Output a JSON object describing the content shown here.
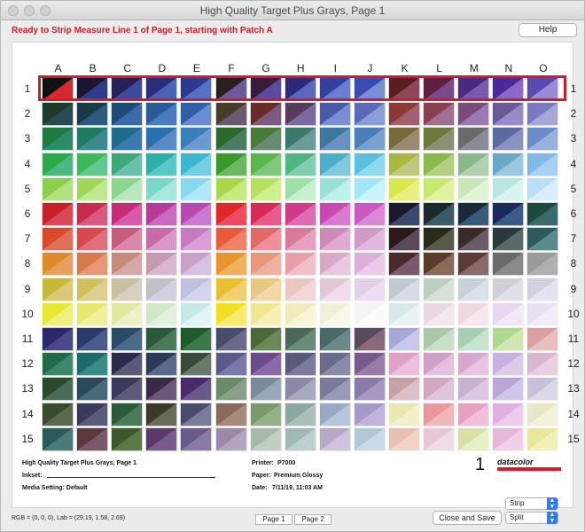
{
  "window": {
    "title": "High Quality Target Plus Grays, Page 1"
  },
  "status": {
    "text": "Ready to Strip Measure Line 1 of Page 1, starting with Patch A"
  },
  "toolbar": {
    "help_label": "Help"
  },
  "target": {
    "columns": [
      "A",
      "B",
      "C",
      "D",
      "E",
      "F",
      "G",
      "H",
      "I",
      "J",
      "K",
      "L",
      "M",
      "N",
      "O"
    ],
    "rows": [
      "1",
      "2",
      "3",
      "4",
      "5",
      "6",
      "7",
      "8",
      "9",
      "10",
      "11",
      "12",
      "13",
      "14",
      "15"
    ],
    "highlighted_row_index": 0,
    "patch_colors": [
      [
        "#111111/#d9282c",
        "#1a1632/#2f3b8c",
        "#252055/#3c4aa0",
        "#2a3078/#4a62b8",
        "#2e3a8c/#5570c8",
        "#2a1f20/#6b5a9a",
        "#3a1c3a/#5a4aa0",
        "#2c2a7a/#5a66c0",
        "#3340a0/#6a7ed0",
        "#3a4cb0/#7a8ed8",
        "#5a1e20/#8a4858",
        "#5e2040/#7a4a8a",
        "#4a2a80/#7a5ab0",
        "#4a2a9a/#8a6ac8",
        "#5a4ab0/#9a8ad8"
      ],
      [
        "#1f3a2a/#2a4a55",
        "#1a3a48/#2e5a80",
        "#1e4a78/#3a6aa8",
        "#2a5a98/#4a7ac0",
        "#3060a8/#6a8cd0",
        "#4a3a2a/#6a5a70",
        "#6a2a2a/#7a5a80",
        "#5a3a5a/#7a6aa0",
        "#4a5aa8/#7a8ed0",
        "#5a6ab8/#8a9ed8",
        "#8a3a30/#a06070",
        "#8a4050/#a07090",
        "#7a4a78/#9a7ab0",
        "#6a5a98/#9a8ac8",
        "#7a7ac0/#a8a8d8"
      ],
      [
        "#1e7a40/#2a8a6a",
        "#1e7a60/#3a8a90",
        "#1e6a88/#3a7ab0",
        "#2a70b0/#5a8ac8",
        "#3a80b8/#6a9ad0",
        "#2a6a2a/#4a7a60",
        "#4a7a3a/#6a8a70",
        "#3a7a6a/#6a9a9a",
        "#3a78a0/#6a90c0",
        "#4a80b8/#7aa0d0",
        "#7a6a3a/#9a8a70",
        "#6a7a3a/#8a9070",
        "#6a6a6a/#8a8a98",
        "#5a6aa0/#8a90c0",
        "#6a8ac8/#98b0dc"
      ],
      [
        "#2aa84a/#4ab880",
        "#3ab85a/#60c890",
        "#3aa878/#6ac0a8",
        "#2ab0a8/#5ac8c8",
        "#3ab8d0/#70d0e0",
        "#3a9a2a/#6ab860",
        "#5ab84a/#80c880",
        "#4ab880/#80d0b0",
        "#4ab0c8/#80c8e0",
        "#5ac0e0/#90d8f0",
        "#a8b83a/#c0c880",
        "#8ab84a/#b0d080",
        "#8ab88a/#b0d0b0",
        "#6aa8c8/#98c8e0",
        "#80b8e8/#a8d0f0"
      ],
      [
        "#8ad04a/#b0e080",
        "#a0d85a/#c0e890",
        "#8ad890/#b8e8c0",
        "#7ad8c8/#a8e8e0",
        "#8ad8f0/#b0e8f8",
        "#a8d84a/#c8e880",
        "#b8e060/#d0f090",
        "#a0e0a8/#c8f0d0",
        "#98e0d8/#c0f0ec",
        "#a0e8f8/#c8f4fc",
        "#d8e84a/#e8f080",
        "#c8e870/#e0f4a0",
        "#c8e8b8/#e0f4d8",
        "#b8e8e0/#d8f4f0",
        "#b8e0f8/#d8eefc"
      ],
      [
        "#c81e2a/#d84858",
        "#c82a4a/#d85a80",
        "#c82a7a/#d85aa8",
        "#b83a98/#c86ac0",
        "#b84ab0/#c87ad0",
        "#e02828/#f04a60",
        "#d82a5a/#e85a88",
        "#d03a8a/#e06ab0",
        "#c84ab0/#d87ad0",
        "#c85ac0/#d88ad8",
        "#1a1a2a/#3a4a6a",
        "#1a2a2a/#3a5a6a",
        "#1a2a3a/#3a5a7a",
        "#1a2a5a/#3a5a8a",
        "#1a4a3a/#3a6a6a"
      ],
      [
        "#d84a2a/#e07058",
        "#d84a4a/#e07080",
        "#c85a7a/#d888a8",
        "#c86aa8/#d898c8",
        "#c87ac0/#d8a0d8",
        "#e85a3a/#f08068",
        "#e06a6a/#f09098",
        "#d87a9a/#e8a0c0",
        "#d08ab8/#e0aad0",
        "#d09ac8/#e0b8e0",
        "#2a1a1a/#5a4a5a",
        "#2a2a1a/#5a5a4a",
        "#3a2a2a/#6a5a6a",
        "#2a3a3a/#5a6a6a",
        "#2a5a5a/#5a8a8a"
      ],
      [
        "#e0882a/#e8a060",
        "#d87a4a/#e89878",
        "#c88a7a/#d8a8a8",
        "#c89ab0/#d8b8d0",
        "#c8a0c8/#d8c0e0",
        "#e8982a/#f0b060",
        "#e8987a/#f0b0a0",
        "#e8a0a8/#f0c0c8",
        "#d8a8c8/#e8c8e0",
        "#d8b0d8/#e8cce8",
        "#4a2a2a/#7a5a6a",
        "#5a3a2a/#8a6a5a",
        "#5a3a3a/#8a6a6a",
        "#6a6a6a/#8a8a8a",
        "#9a9a9a/#b0b0b0"
      ],
      [
        "#c8b83a/#d8c878",
        "#d0c060/#e0d090",
        "#c8c0a0/#d8d0c0",
        "#c0c0c8/#d0d0e0",
        "#c0c0e0/#d4d4f0",
        "#e8c030/#f0d070",
        "#e8c880/#f0d8a8",
        "#e8c8c0/#f0d8d8",
        "#e0c8d8/#f0dcea",
        "#e0d0e8/#ecdcf4",
        "#c0c8d0/#d8dce8",
        "#c0d0c0/#d8e0d8",
        "#c8d0d8/#dce0ea",
        "#d0d0d8/#e0e0e8",
        "#d0d0e0/#e4e4f0"
      ],
      [
        "#e8e830/#f0f080",
        "#e8e870/#f0f0a0",
        "#e0e8a0/#eef0c8",
        "#d0e8c8/#e4f0e0",
        "#c8e8e8/#e0f4f4",
        "#f0e020/#f8ec70",
        "#f0e890/#f8f0b8",
        "#f0ecc0/#f8f4d8",
        "#f0f0d8/#f8f8e8",
        "#f4f4f4/#fbfbfb",
        "#d8e8e8/#eaf2f2",
        "#e8d8e0/#f2e8ee",
        "#f0d8e0/#f8e8ee",
        "#e8d8f0/#f4e8f8",
        "#e8e0f0/#f2ecf8"
      ],
      [
        "#2a2a6a/#4a4a8a",
        "#2a3a6a/#4a5a8a",
        "#2a4a6a/#4a6a8a",
        "#2a5a3a/#4a7a5a",
        "#1e5a2a/#3a7a4a",
        "#4a4a6a/#6a6a8a",
        "#4a6a3a/#6a8a5a",
        "#4a6a5a/#6a8a7a",
        "#4a6a6a/#6a8a8a",
        "#5a4a5a/#8a6a7a",
        "#a8a8d8/#c8c8e8",
        "#a8c8a8/#c8e0c8",
        "#a8d0b0/#c8e4d0",
        "#b0d890/#d0e8b0",
        "#d8a0a0/#e8c0c0"
      ],
      [
        "#1e6a4a/#3a8a6a",
        "#1e6a6a/#3a8a8a",
        "#2a2a4a/#5a5a7a",
        "#2a3a5a/#5a6a8a",
        "#3a4a3a/#6a7a6a",
        "#5a5a8a/#7a7aa8",
        "#6a4a8a/#8a6aa8",
        "#5a5a7a/#7a7a9a",
        "#6a6a8a/#8a8aaa",
        "#7a5a8a/#9a7aaa",
        "#e0a0c8/#ecc0dc",
        "#d0a0c8/#e4c0dc",
        "#d8a8d0/#e8c4e0",
        "#c8b0e0/#dccce8",
        "#d8b8d0/#e8d0e0"
      ],
      [
        "#2a4a2a/#4a6a5a",
        "#2a4a5a/#4a6a7a",
        "#3a3a5a/#5a5a7a",
        "#3a2a4a/#6a5a7a",
        "#4a2a6a/#6a5a8a",
        "#6a8a6a/#8aa08a",
        "#7a8a9a/#98a8b8",
        "#8a8aa8/#a8a8c0",
        "#7a7a9a/#9898b8",
        "#8a7aa8/#a898c0",
        "#c8a0a8/#dcc0c8",
        "#d0a8c0/#e0c4d8",
        "#c8b0d0/#dcc8e0",
        "#b8a8d8/#d0c4e8",
        "#c8c0d8/#dcd8e8"
      ],
      [
        "#3a4a2a/#5a6a4a",
        "#3a3a5a/#5a5a7a",
        "#2a5a3a/#4a7a5a",
        "#3a3a2a/#6a6a5a",
        "#4a4a6a/#7a7a9a",
        "#8a6a5a/#a88a7a",
        "#7a9a6a/#98b08a",
        "#8aa8a0/#a8c0b8",
        "#9aa8c8/#b8c4dc",
        "#a898c8/#c0b4dc",
        "#e8e8b0/#f0f0cc",
        "#e89898/#f0b8b8",
        "#e8a0c0/#f0c0d8",
        "#e0b0e0/#ecccec",
        "#e8e8c8/#f2f2dc"
      ],
      [
        "#2a5a5a/#4a7a7a",
        "#5a3a3a/#7a5a6a",
        "#3a5a2a/#5a7a4a",
        "#5a3a6a/#7a5a8a",
        "#6a5a8a/#8a7aa8",
        "#9a8aa8/#b0a4c0",
        "#a8b8a8/#c0d0c0",
        "#a0b8b8/#bcd0d0",
        "#b8a8c8/#d0c4dc",
        "#b0c8d8/#c8dce8",
        "#e8c0b0/#f0d4c8",
        "#e8c8d8/#f0dce8",
        "#d8e0a8/#e8f0c8",
        "#e8b8d8/#f0d0e8",
        "#e8e898/#f0f0b8"
      ]
    ]
  },
  "footer": {
    "target_name": "High Quality Target Plus Grays, Page 1",
    "inkset_label": "Inkset:",
    "media_setting": "Media Setting: Default",
    "printer_label": "Printer:",
    "printer_value": "P7000",
    "paper_label": "Paper:",
    "paper_value": "Premium Glossy",
    "date_label": "Date:",
    "date_value": "7/11/19, 11:03 AM",
    "page_number": "1",
    "brand": "datacolor"
  },
  "bottom_bar": {
    "rgb_readout": "RGB = (0, 0, 0), Lab = (29.19, 1.58, 2.69)",
    "page_tabs": [
      "Page 1",
      "Page 2"
    ],
    "close_save_label": "Close and Save",
    "mode_select_value": "Strip",
    "view_select_value": "Split"
  }
}
